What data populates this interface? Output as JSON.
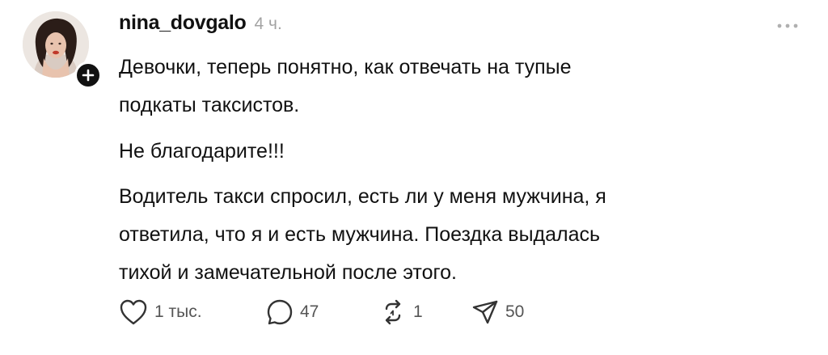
{
  "post": {
    "username": "nina_dovgalo",
    "time": "4 ч.",
    "paragraphs": [
      "Девочки, теперь понятно, как отвечать на тупые\nподкаты таксистов.",
      "Не благодарите!!!",
      "Водитель такси спросил, есть ли у меня мужчина, я\nответила, что я и есть мужчина. Поездка выдалась\nтихой и замечательной после этого."
    ]
  },
  "icons": {
    "follow": "plus-icon",
    "more": "ellipsis-icon",
    "like": "heart-icon",
    "reply": "comment-icon",
    "repost": "repost-icon",
    "share": "send-icon"
  },
  "actions": {
    "likes": "1 тыс.",
    "replies": "47",
    "reposts": "1",
    "shares": "50"
  },
  "colors": {
    "text": "#111111",
    "muted": "#a3a3a3",
    "icon": "#333333"
  }
}
